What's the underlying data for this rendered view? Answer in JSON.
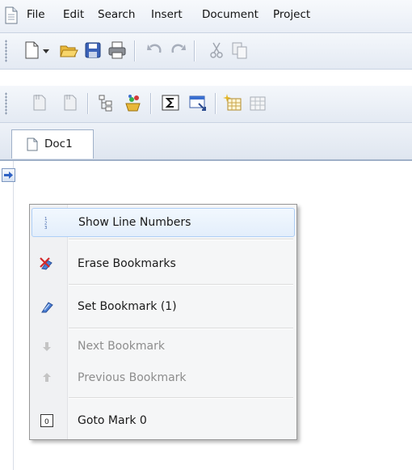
{
  "menubar": {
    "items": [
      "File",
      "Edit",
      "Search",
      "Insert",
      "Document",
      "Project"
    ]
  },
  "toolbar1": {
    "buttons": [
      "new-document-icon",
      "dropdown-arrow-icon",
      "open-folder-icon",
      "save-icon",
      "print-icon",
      "undo-icon",
      "redo-icon",
      "cut-icon",
      "copy-icon"
    ]
  },
  "toolbar2": {
    "buttons": [
      "page-icon",
      "page-icon",
      "tree-view-icon",
      "wizard-icon",
      "sigma-icon",
      "dialog-icon",
      "grid-sparkle-icon",
      "grid-icon"
    ]
  },
  "tabs": [
    {
      "label": "Doc1"
    }
  ],
  "context_menu": {
    "items": [
      {
        "label": "Show Line Numbers",
        "icon": "line-numbers-icon",
        "highlighted": true,
        "enabled": true
      },
      {
        "label": "Erase Bookmarks",
        "icon": "erase-bookmarks-icon",
        "enabled": true
      },
      {
        "label": "Set Bookmark (1)",
        "icon": "set-bookmark-icon",
        "enabled": true
      },
      {
        "label": "Next Bookmark",
        "icon": "down-arrow-icon",
        "enabled": false
      },
      {
        "label": "Previous Bookmark",
        "icon": "up-arrow-icon",
        "enabled": false
      },
      {
        "label": "Goto Mark 0",
        "icon": "goto-mark-icon",
        "enabled": true
      }
    ],
    "goto_mark_glyph": "0"
  }
}
